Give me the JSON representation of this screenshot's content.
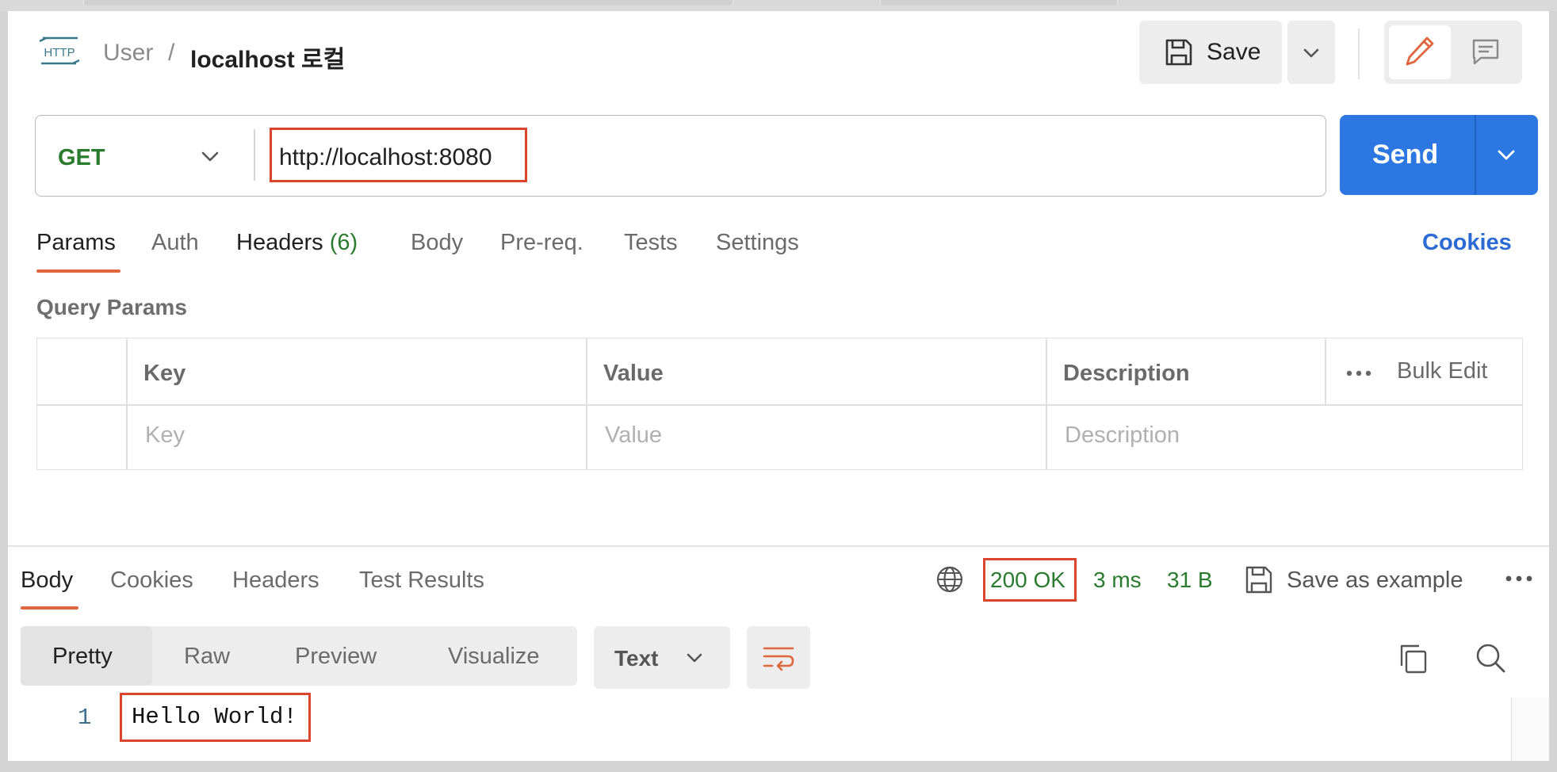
{
  "header": {
    "protocol_icon": "http-icon",
    "breadcrumb_parent": "User",
    "breadcrumb_separator": "/",
    "request_title": "localhost 로컬",
    "save_label": "Save"
  },
  "request": {
    "method": "GET",
    "url": "http://localhost:8080",
    "send_label": "Send"
  },
  "request_tabs": {
    "params": "Params",
    "auth": "Auth",
    "headers": "Headers",
    "headers_count": "(6)",
    "body": "Body",
    "prereq": "Pre-req.",
    "tests": "Tests",
    "settings": "Settings",
    "cookies": "Cookies"
  },
  "query_params": {
    "title": "Query Params",
    "columns": [
      "Key",
      "Value",
      "Description"
    ],
    "placeholders": [
      "Key",
      "Value",
      "Description"
    ],
    "bulk_edit": "Bulk Edit"
  },
  "response": {
    "tabs": [
      "Body",
      "Cookies",
      "Headers",
      "Test Results"
    ],
    "status": "200 OK",
    "time": "3 ms",
    "size": "31 B",
    "save_example": "Save as example",
    "view_tabs": [
      "Pretty",
      "Raw",
      "Preview",
      "Visualize"
    ],
    "format": "Text",
    "lines": [
      {
        "number": "1",
        "text": "Hello World!"
      }
    ]
  },
  "colors": {
    "accent_orange": "#e0673d",
    "send_blue": "#2d77e2",
    "method_green": "#2a7b2e",
    "highlight_red": "#d9462c",
    "link_blue": "#2d6bd4"
  }
}
